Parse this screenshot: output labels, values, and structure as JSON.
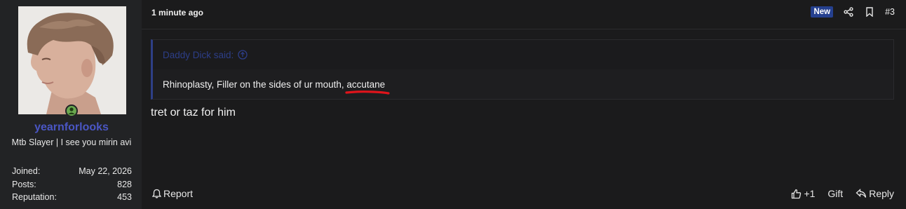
{
  "user": {
    "username": "yearnforlooks",
    "title": "Mtb Slayer | I see you mirin avi",
    "online": true,
    "stats": [
      {
        "label": "Joined:",
        "value": "May 22, 2026"
      },
      {
        "label": "Posts:",
        "value": "828"
      },
      {
        "label": "Reputation:",
        "value": "453"
      }
    ]
  },
  "post": {
    "time": "1 minute ago",
    "badge": "New",
    "number": "#3",
    "quote": {
      "author_line": "Daddy Dick said:",
      "text_before": "Rhinoplasty, Filler on the sides of ur mouth, ",
      "highlighted_word": "accutane",
      "highlight_color": "#e0141b"
    },
    "message": "tret or taz for him"
  },
  "footer": {
    "report_label": "Report",
    "like_label": "+1",
    "gift_label": "Gift",
    "reply_label": "Reply"
  },
  "colors": {
    "username": "#4a56c4",
    "badge": "#25408f",
    "quote_accent": "#2e3f86",
    "online": "#6aa84f"
  },
  "icons": {
    "share": "share-icon",
    "bookmark": "bookmark-icon",
    "quote_jump": "arrow-up-circle-icon",
    "report": "bell-icon",
    "like": "thumbs-up-icon",
    "reply": "reply-arrow-icon"
  }
}
